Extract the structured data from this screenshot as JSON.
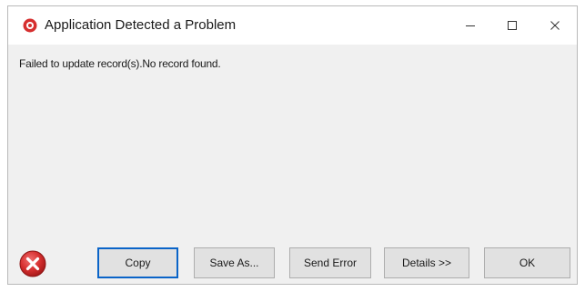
{
  "window": {
    "title": "Application Detected a Problem",
    "message": "Failed to update record(s).No record found."
  },
  "buttons": {
    "copy": "Copy",
    "save_as": "Save As...",
    "send_error": "Send Error",
    "details": "Details >>",
    "ok": "OK"
  },
  "icons": {
    "app": "error-circle-icon",
    "status": "error-x-icon",
    "minimize": "minimize-icon",
    "maximize": "maximize-icon",
    "close": "close-icon"
  },
  "colors": {
    "error_red": "#d62f2f",
    "dialog_background": "#f0f0f0",
    "button_background": "#e1e1e1",
    "focus_border": "#0a64c8"
  }
}
